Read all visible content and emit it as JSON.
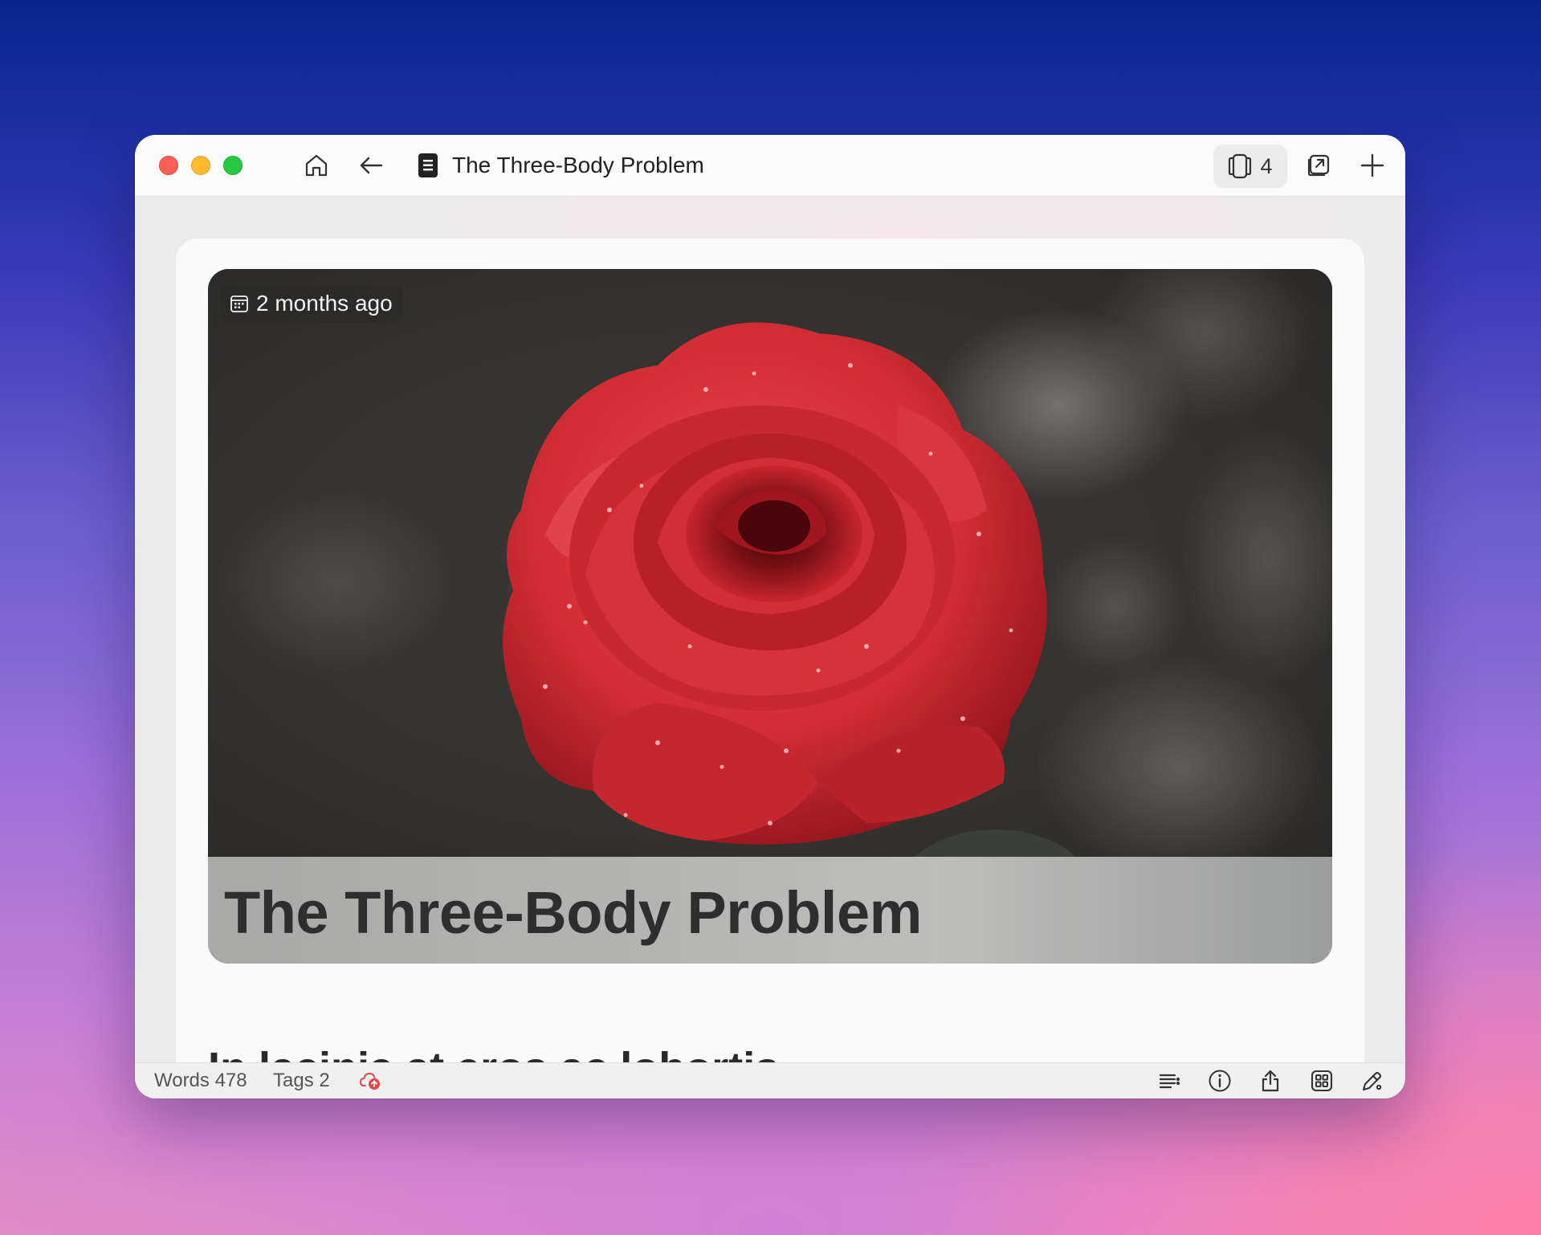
{
  "window": {
    "title": "The Three-Body Problem",
    "open_tabs_count": "4"
  },
  "cover": {
    "date_label": "2 months ago",
    "title": "The Three-Body Problem"
  },
  "content": {
    "heading": "In lacinia at eros ac lobortis"
  },
  "status": {
    "words": "Words 478",
    "tags": "Tags 2"
  },
  "colors": {
    "sync_error": "#e54848",
    "close": "#fe5f57",
    "minimize": "#febc2e",
    "zoom": "#28c840"
  }
}
